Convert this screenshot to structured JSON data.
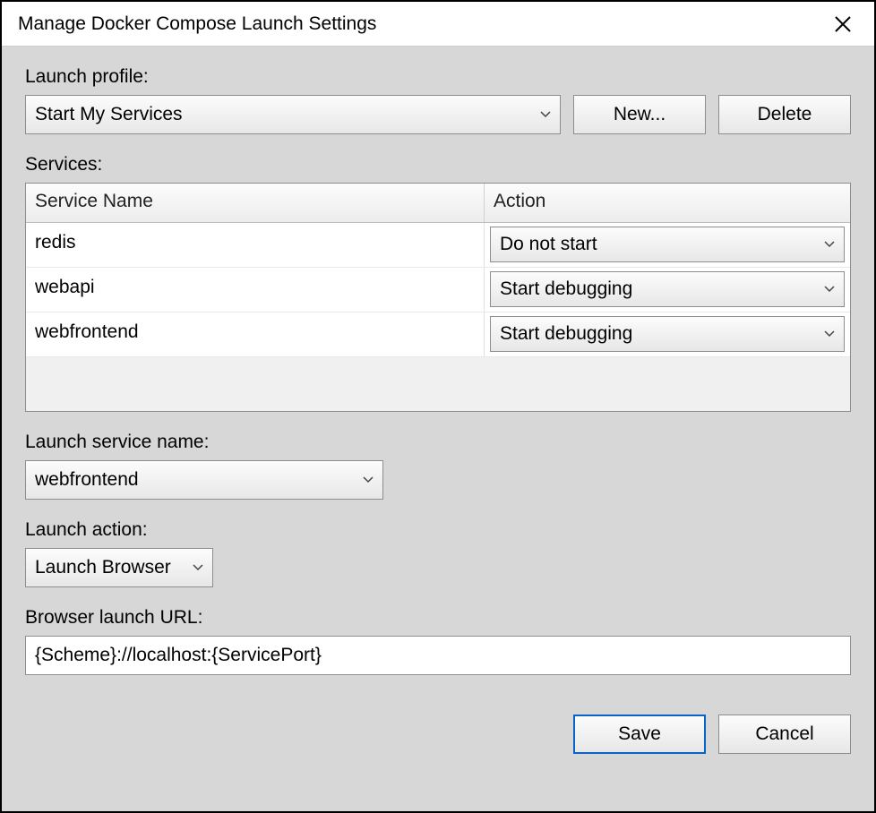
{
  "window": {
    "title": "Manage Docker Compose Launch Settings"
  },
  "launch_profile": {
    "label": "Launch profile:",
    "selected": "Start My Services",
    "new_button": "New...",
    "delete_button": "Delete"
  },
  "services": {
    "label": "Services:",
    "headers": {
      "name": "Service Name",
      "action": "Action"
    },
    "rows": [
      {
        "name": "redis",
        "action": "Do not start"
      },
      {
        "name": "webapi",
        "action": "Start debugging"
      },
      {
        "name": "webfrontend",
        "action": "Start debugging"
      }
    ]
  },
  "launch_service_name": {
    "label": "Launch service name:",
    "value": "webfrontend"
  },
  "launch_action": {
    "label": "Launch action:",
    "value": "Launch Browser"
  },
  "browser_launch_url": {
    "label": "Browser launch URL:",
    "value": "{Scheme}://localhost:{ServicePort}"
  },
  "footer": {
    "save": "Save",
    "cancel": "Cancel"
  }
}
